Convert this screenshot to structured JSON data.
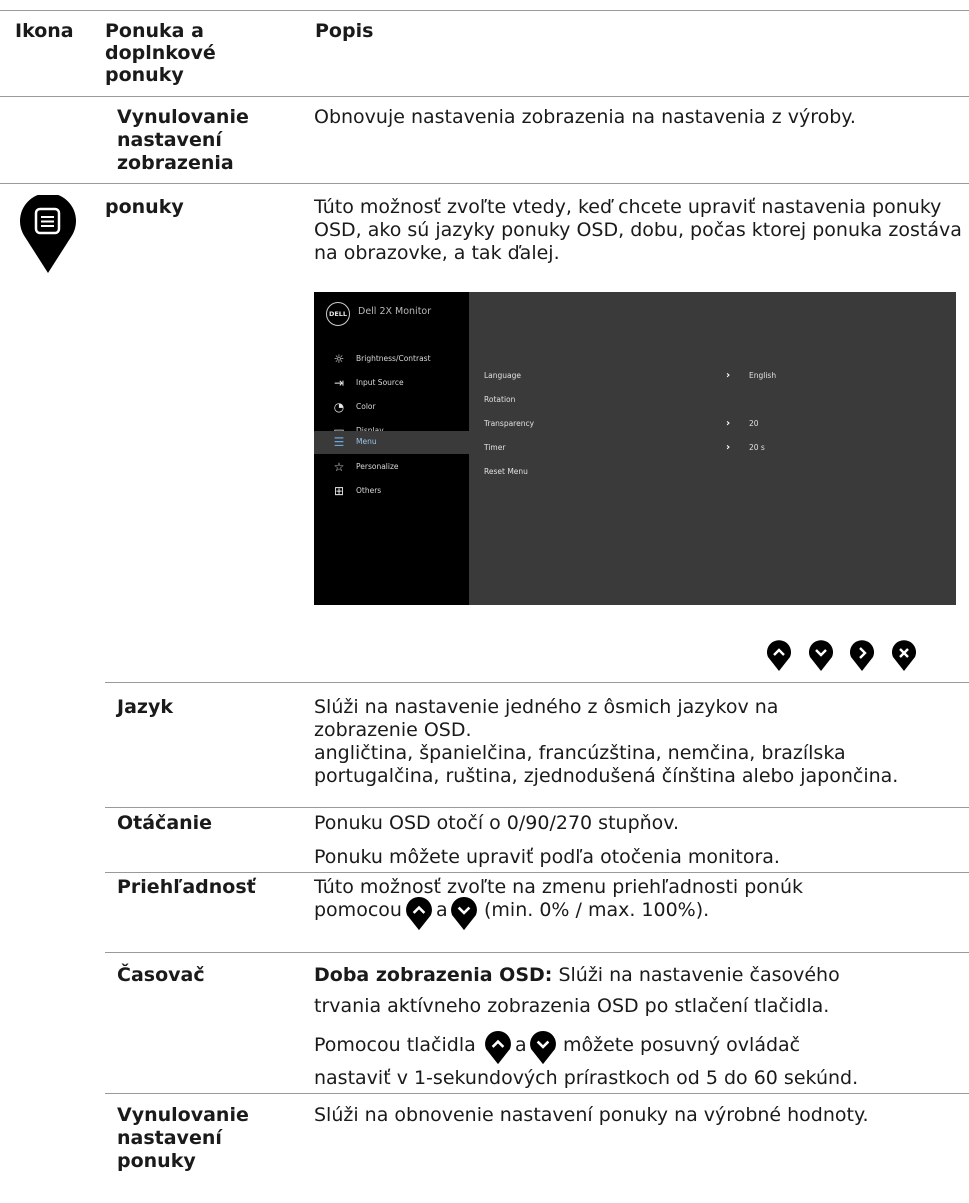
{
  "header": {
    "col_icon": "Ikona",
    "col_menu": "Ponuka a doplnkové ponuky",
    "col_desc": "Popis"
  },
  "rows": [
    {
      "term": "Vynulovanie nastavení zobrazenia",
      "desc": "Obnovuje nastavenia zobrazenia na nastavenia z výroby."
    },
    {
      "term": "ponuky",
      "desc": "Túto možnosť zvoľte vtedy, keď chcete upraviť nastavenia ponuky OSD, ako sú jazyky ponuky OSD, dobu, počas ktorej ponuka zostáva na obrazovke, a tak ďalej."
    },
    {
      "term": "Jazyk",
      "desc1": "Slúži na nastavenie jedného z ôsmich jazykov na zobrazenie OSD.",
      "desc2": "angličtina, španielčina, francúzština, nemčina, brazílska portugalčina, ruština, zjednodušená čínština alebo japončina."
    },
    {
      "term": "Otáčanie",
      "desc1": "Ponuku OSD otočí o 0/90/270 stupňov.",
      "desc2": "Ponuku môžete upraviť podľa otočenia monitora."
    },
    {
      "term": "Priehľadnosť",
      "desc_a": "Túto možnosť zvoľte na zmenu priehľadnosti ponúk",
      "desc_b": "pomocou",
      "desc_c": "a",
      "desc_d": "(min. 0% / max. 100%)."
    },
    {
      "term": "Časovač",
      "lead": "Doba zobrazenia OSD:",
      "desc1": "Slúži na nastavenie časového",
      "desc2": "trvania aktívneho zobrazenia OSD po stlačení tlačidla.",
      "desc3_a": "Pomocou tlačidla",
      "desc3_b": "a",
      "desc3_c": "môžete posuvný ovládač",
      "desc4": "nastaviť v 1-sekundových prírastkoch od 5 do 60 sekúnd."
    },
    {
      "term": "Vynulovanie nastavení ponuky",
      "desc": "Slúži na obnovenie nastavení ponuky na výrobné hodnoty."
    }
  ],
  "osd": {
    "logo": "DELL",
    "model": "Dell 2X Monitor",
    "menu": [
      {
        "label": "Brightness/Contrast",
        "icon": "sun-icon"
      },
      {
        "label": "Input Source",
        "icon": "input-icon"
      },
      {
        "label": "Color",
        "icon": "palette-icon"
      },
      {
        "label": "Display",
        "icon": "monitor-icon"
      },
      {
        "label": "Menu",
        "icon": "menu-icon",
        "active": true
      },
      {
        "label": "Personalize",
        "icon": "star-icon"
      },
      {
        "label": "Others",
        "icon": "others-icon"
      }
    ],
    "settings": [
      {
        "name": "Language",
        "value": "English",
        "arrow": true
      },
      {
        "name": "Rotation",
        "value": "",
        "arrow": false
      },
      {
        "name": "Transparency",
        "value": "20",
        "arrow": true
      },
      {
        "name": "Timer",
        "value": "20 s",
        "arrow": true
      },
      {
        "name": "Reset Menu",
        "value": "",
        "arrow": false
      }
    ]
  },
  "buttons": [
    "up-button",
    "down-button",
    "right-button",
    "close-button"
  ],
  "colors": {
    "pin": "#000000",
    "rule": "#9a9a9a",
    "osd_bg": "#3a3a3a",
    "osd_side": "#000000",
    "osd_active": "#6ea3d6"
  }
}
